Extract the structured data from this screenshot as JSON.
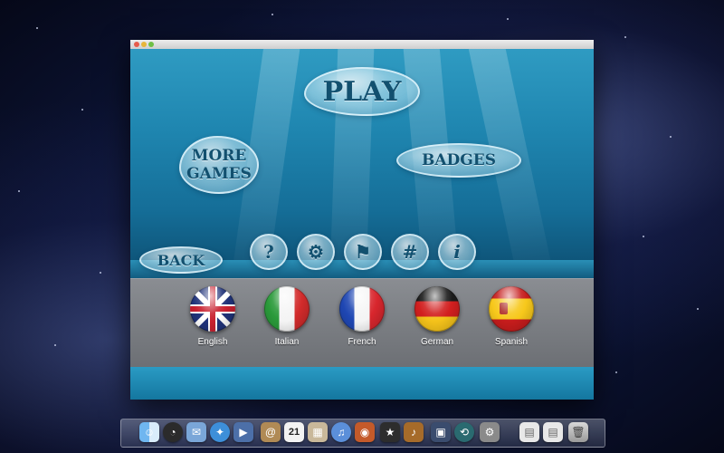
{
  "game": {
    "play_label": "PLAY",
    "more_games_label_line1": "MORE",
    "more_games_label_line2": "GAMES",
    "badges_label": "BADGES",
    "back_label": "BACK",
    "icon_buttons": [
      {
        "name": "help-icon",
        "glyph": "?"
      },
      {
        "name": "settings-icon",
        "glyph": "⚙"
      },
      {
        "name": "flag-icon",
        "glyph": "⚑"
      },
      {
        "name": "hash-icon",
        "glyph": "#"
      },
      {
        "name": "info-icon",
        "glyph": "i"
      }
    ],
    "languages": [
      {
        "label": "English",
        "flag": "uk-flag-icon"
      },
      {
        "label": "Italian",
        "flag": "italy-flag-icon"
      },
      {
        "label": "French",
        "flag": "france-flag-icon"
      },
      {
        "label": "German",
        "flag": "germany-flag-icon"
      },
      {
        "label": "Spanish",
        "flag": "spain-flag-icon"
      }
    ]
  },
  "dock": {
    "calendar_day": "21",
    "items": [
      "finder-icon",
      "dashboard-icon",
      "mail-icon",
      "safari-icon",
      "facetime-icon",
      "address-book-icon",
      "calendar-icon",
      "preview-icon",
      "itunes-icon",
      "photo-booth-icon",
      "imovie-icon",
      "garageband-icon",
      "mission-control-icon",
      "time-machine-icon",
      "system-preferences-icon",
      "documents-stack-icon",
      "downloads-stack-icon",
      "trash-icon"
    ]
  },
  "colors": {
    "water": "#1f86b0",
    "bubble_text": "#12506f",
    "language_bar": "#7b7e83"
  }
}
